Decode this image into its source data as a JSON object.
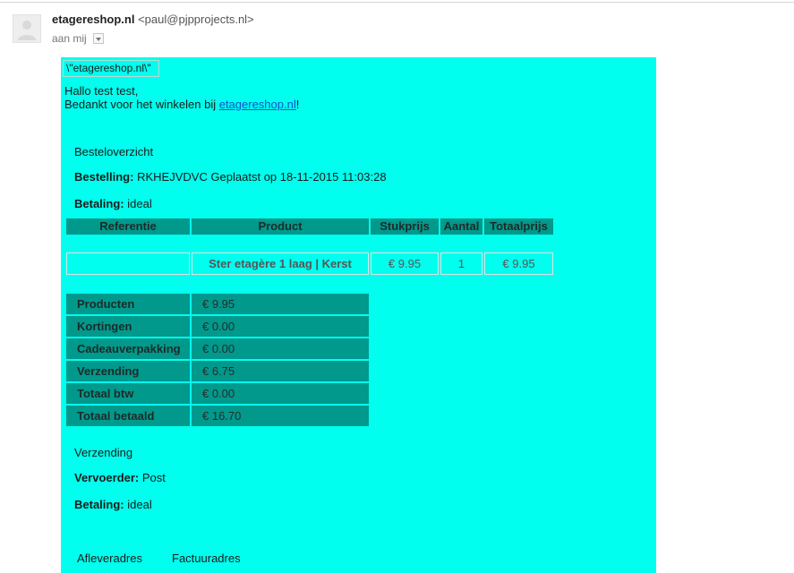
{
  "email": {
    "sender_name": "etagereshop.nl",
    "sender_email": "<paul@pjpprojects.nl>",
    "recipient": "aan mij",
    "avatar_icon": "person-icon",
    "recipient_menu_icon": "chevron-down-icon"
  },
  "body": {
    "logo_alt": "\\\"etagereshop.nl\\\"",
    "greeting": "Hallo test test,",
    "thanks_prefix": "Bedankt voor het winkelen bij ",
    "thanks_link": "etagereshop.nl",
    "thanks_suffix": "!",
    "order_overview": {
      "heading": "Besteloverzicht",
      "order_label": "Bestelling:",
      "order_value": "RKHEJVDVC Geplaatst op 18-11-2015 11:03:28",
      "payment_label": "Betaling:",
      "payment_value": "ideal"
    },
    "items_table": {
      "headers": [
        "Referentie",
        "Product",
        "Stukprijs",
        "Aantal",
        "Totaalprijs"
      ],
      "rows": [
        [
          "",
          "Ster etagère 1 laag | Kerst",
          "€ 9.95",
          "1",
          "€ 9.95"
        ]
      ]
    },
    "totals": [
      {
        "label": "Producten",
        "value": "€ 9.95"
      },
      {
        "label": "Kortingen",
        "value": "€ 0.00"
      },
      {
        "label": "Cadeauverpakking",
        "value": "€ 0.00"
      },
      {
        "label": "Verzending",
        "value": "€ 6.75"
      },
      {
        "label": "Totaal btw",
        "value": "€ 0.00"
      },
      {
        "label": "Totaal betaald",
        "value": "€ 16.70"
      }
    ],
    "shipping": {
      "heading": "Verzending",
      "carrier_label": "Vervoerder:",
      "carrier_value": "Post",
      "payment_label": "Betaling:",
      "payment_value": "ideal"
    },
    "addresses": {
      "delivery": "Afleveradres",
      "billing": "Factuuradres"
    }
  },
  "colors": {
    "email_background": "#00ffee",
    "table_cell": "#00998c",
    "link": "#1155cc"
  }
}
